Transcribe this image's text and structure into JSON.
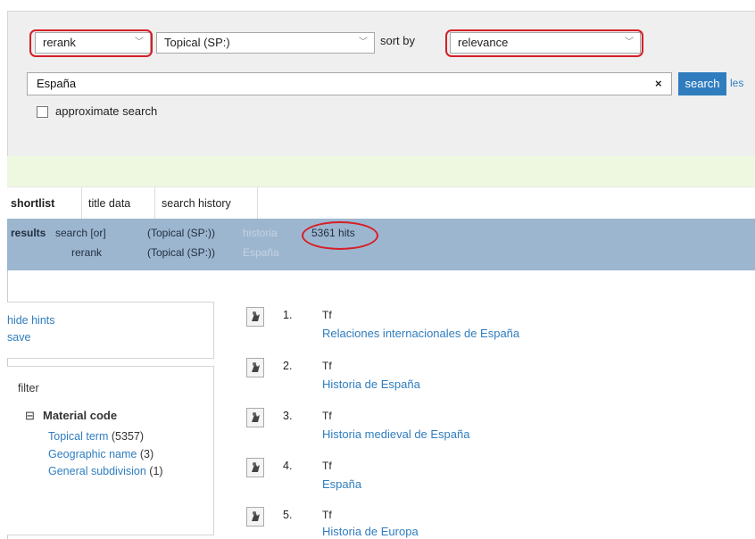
{
  "search_panel": {
    "mode_select": "rerank",
    "index_select": "Topical (SP:)",
    "sort_label": "sort by",
    "sort_select": "relevance",
    "query": "España",
    "clear_glyph": "×",
    "search_button": "search",
    "less_link": "les",
    "approximate_label": "approximate search",
    "approximate_checked": false
  },
  "tabs": [
    {
      "label": "shortlist",
      "active": true
    },
    {
      "label": "title data",
      "active": false
    },
    {
      "label": "search history",
      "active": false
    }
  ],
  "results_bar": {
    "heading": "results",
    "line1": {
      "action": "search [or]",
      "index": "(Topical (SP:))",
      "term": "historia"
    },
    "line2": {
      "action": "rerank",
      "index": "(Topical (SP:))",
      "term": "España"
    },
    "hits": "5361 hits"
  },
  "sidebar": {
    "hide_hints": "hide hints",
    "save": "save",
    "filter_title": "filter",
    "facet_group": "Material code",
    "facet_toggle": "⊟",
    "facets": [
      {
        "label": "Topical term",
        "count": "(5357)"
      },
      {
        "label": "Geographic name",
        "count": "(3)"
      },
      {
        "label": "General subdivision",
        "count": "(1)"
      }
    ]
  },
  "results": [
    {
      "num": "1.",
      "code": "Tf",
      "title": "Relaciones internacionales de España"
    },
    {
      "num": "2.",
      "code": "Tf",
      "title": "Historia de España"
    },
    {
      "num": "3.",
      "code": "Tf",
      "title": "Historia medieval de España"
    },
    {
      "num": "4.",
      "code": "Tf",
      "title": "España"
    },
    {
      "num": "5.",
      "code": "Tf",
      "title": "Historia de Europa"
    }
  ],
  "colors": {
    "accent": "#2f7dbf",
    "results_bar": "#9db6d0",
    "highlight_circle": "#d51f26",
    "green_bar": "#eef8e0"
  }
}
